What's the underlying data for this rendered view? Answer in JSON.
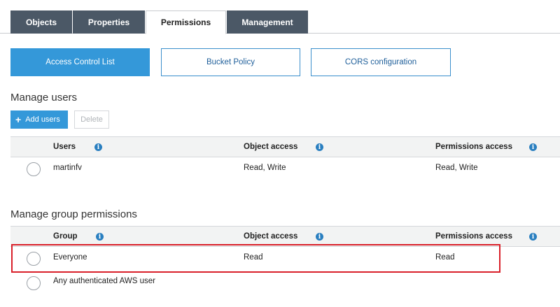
{
  "tabs": [
    {
      "label": "Objects"
    },
    {
      "label": "Properties"
    },
    {
      "label": "Permissions"
    },
    {
      "label": "Management"
    }
  ],
  "subtabs": [
    {
      "label": "Access Control List"
    },
    {
      "label": "Bucket Policy"
    },
    {
      "label": "CORS configuration"
    }
  ],
  "manage_users": {
    "title": "Manage users",
    "add_label": "Add users",
    "delete_label": "Delete",
    "columns": [
      "Users",
      "Object access",
      "Permissions access"
    ],
    "rows": [
      {
        "name": "martinfv",
        "object_access": "Read, Write",
        "permissions_access": "Read, Write"
      }
    ]
  },
  "manage_groups": {
    "title": "Manage group permissions",
    "columns": [
      "Group",
      "Object access",
      "Permissions access"
    ],
    "rows": [
      {
        "name": "Everyone",
        "object_access": "Read",
        "permissions_access": "Read"
      },
      {
        "name": "Any authenticated AWS user",
        "object_access": "",
        "permissions_access": ""
      }
    ]
  },
  "colors": {
    "tab_bg": "#4b5866",
    "accent": "#3498d9",
    "highlight": "#d9202a"
  },
  "icons": {
    "info": "info-icon",
    "plus": "plus-icon"
  }
}
